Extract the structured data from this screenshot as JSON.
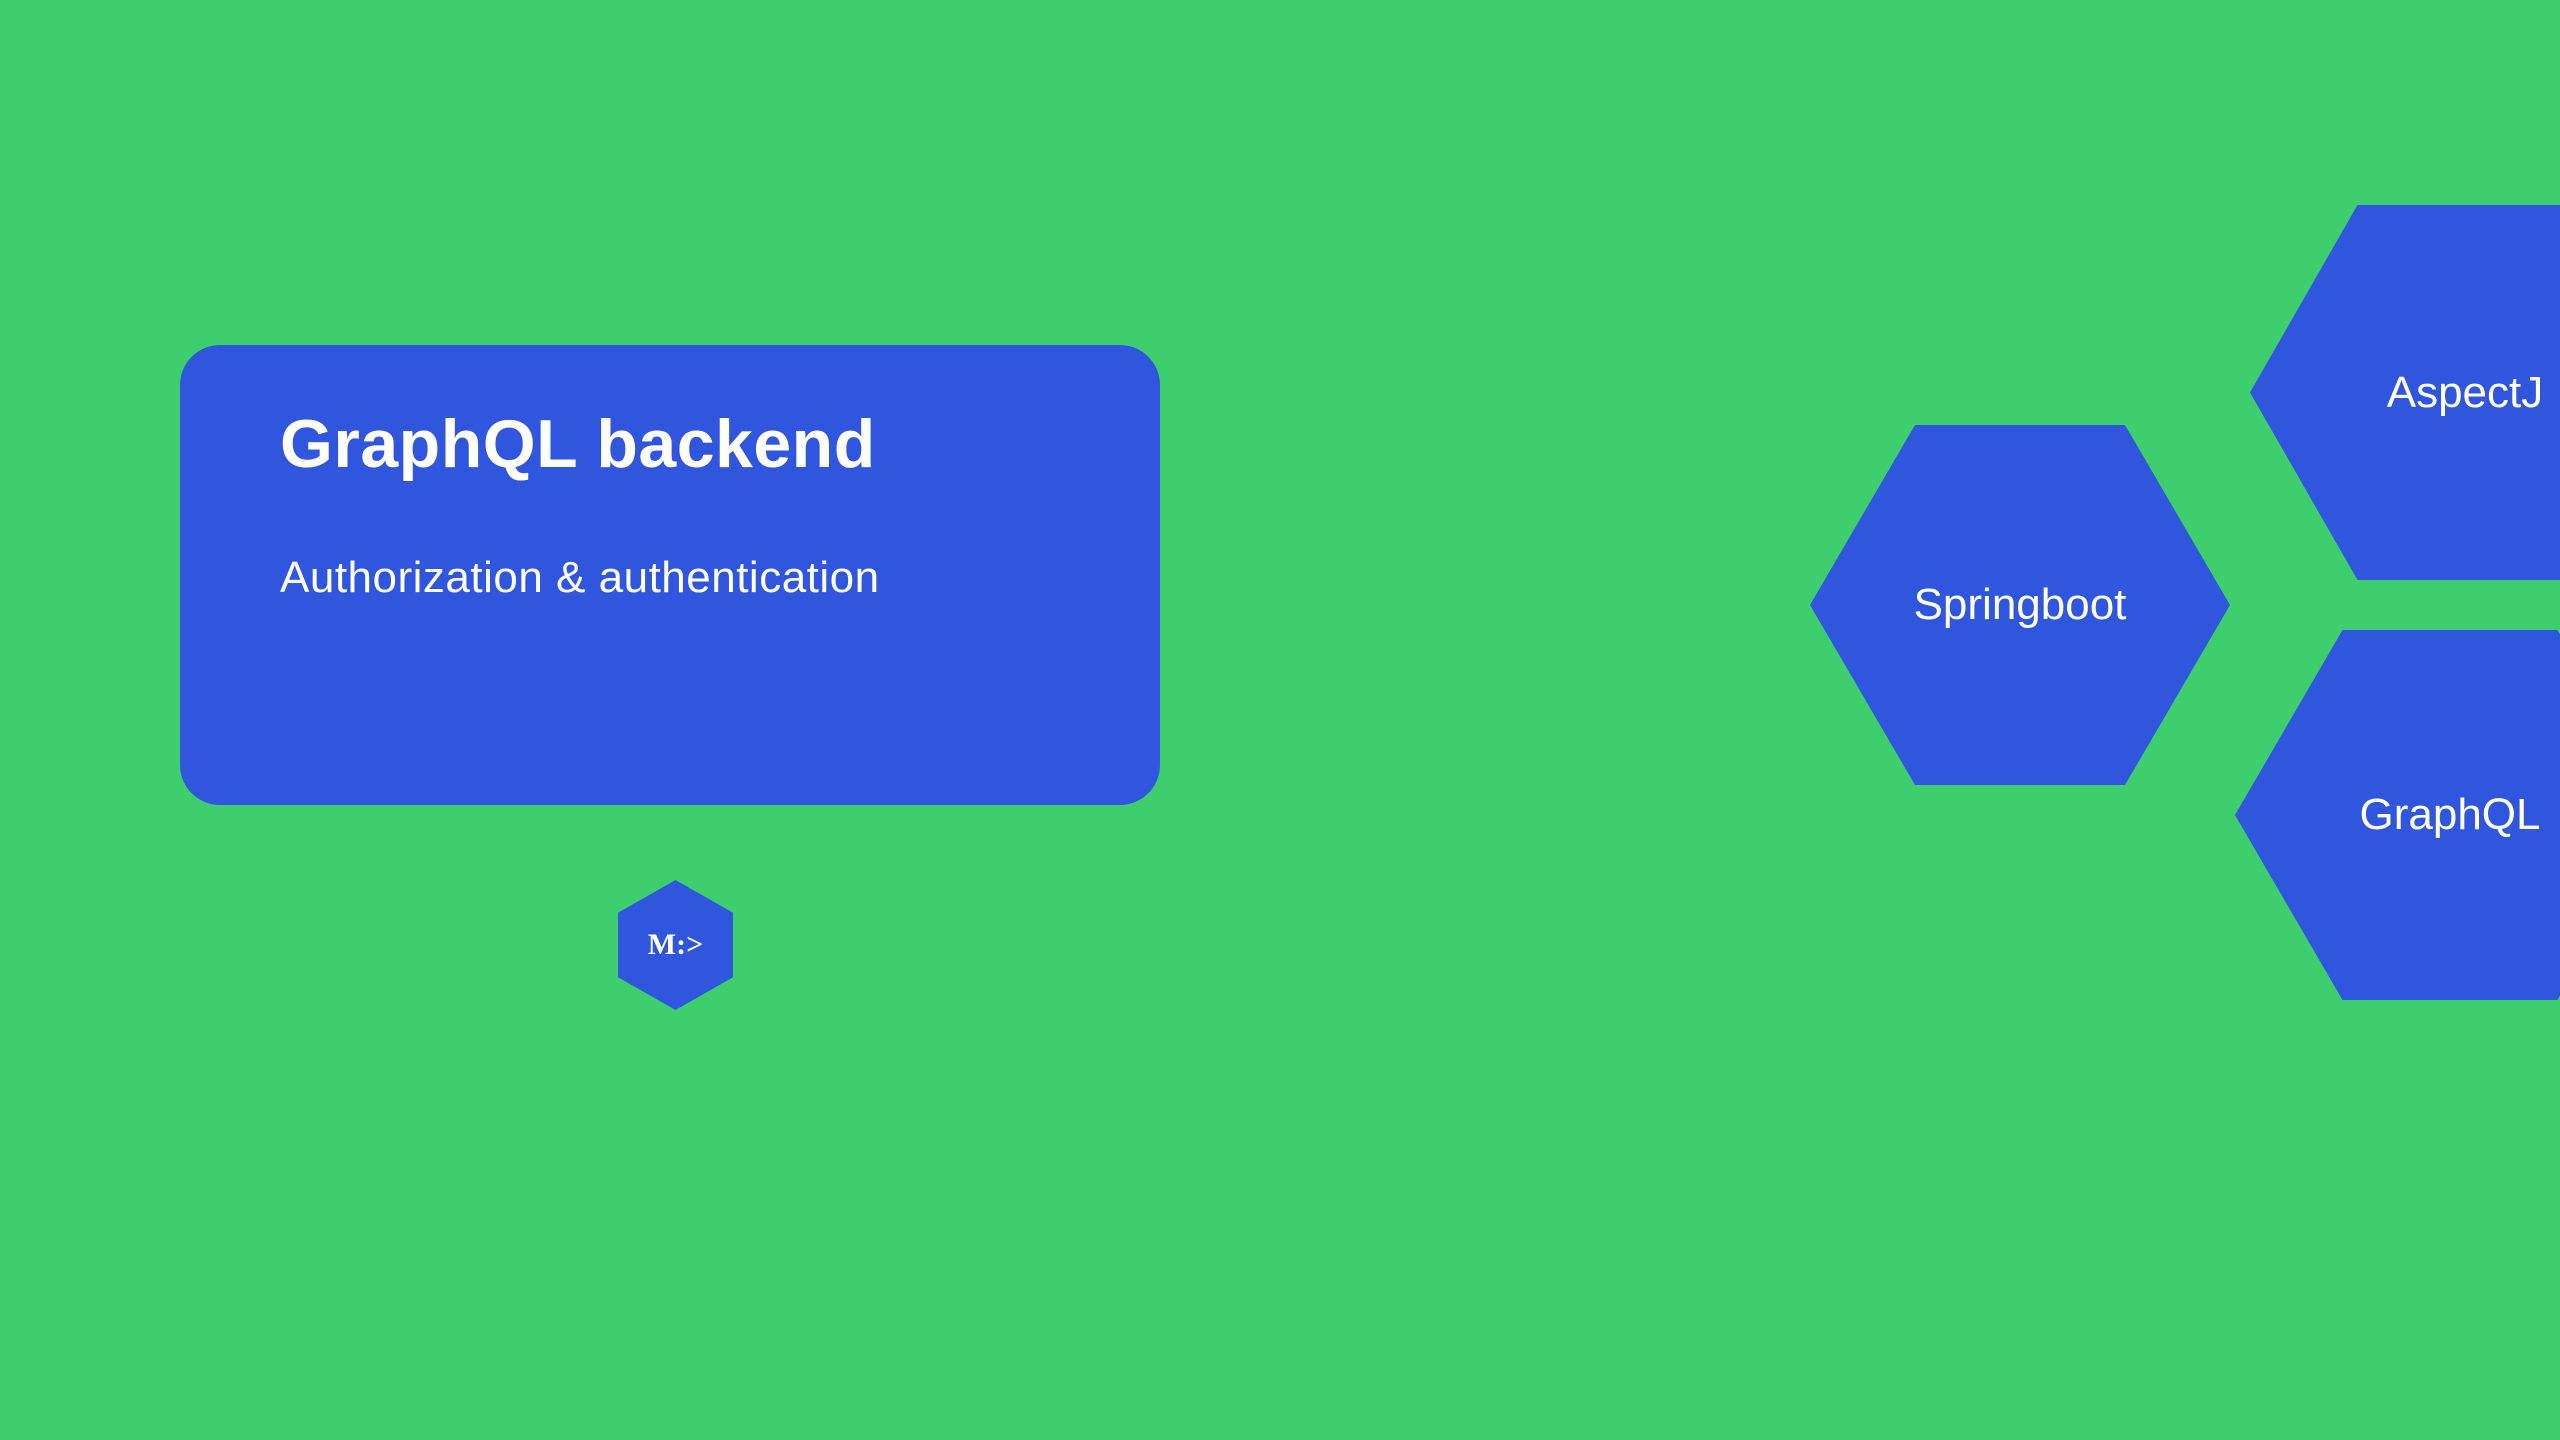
{
  "card": {
    "title": "GraphQL backend",
    "subtitle": "Authorization & authentication"
  },
  "logo": {
    "text": "M:>"
  },
  "hexagons": {
    "left": "Springboot",
    "topRight": "AspectJ",
    "bottomRight": "GraphQL"
  },
  "colors": {
    "background": "#3ece6d",
    "hexFill": "#3056de"
  }
}
